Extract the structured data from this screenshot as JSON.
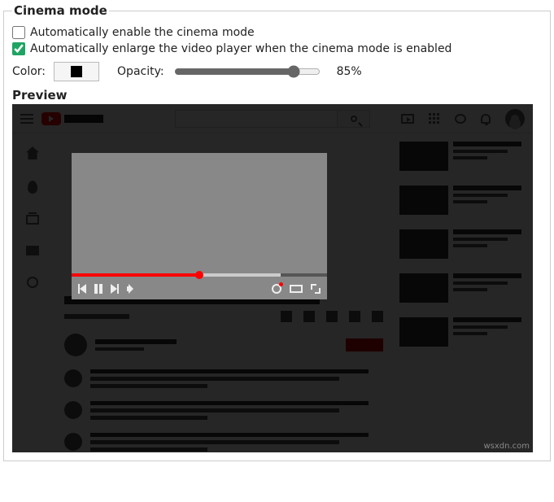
{
  "section": {
    "title": "Cinema mode",
    "auto_enable_label": "Automatically enable the cinema mode",
    "auto_enable_checked": false,
    "auto_enlarge_label": "Automatically enlarge the video player when the cinema mode is enabled",
    "auto_enlarge_checked": true,
    "color_label": "Color:",
    "color_value": "#000000",
    "opacity_label": "Opacity:",
    "opacity_value": 85,
    "opacity_display": "85%",
    "preview_label": "Preview"
  },
  "watermark": "wsxdn.com"
}
